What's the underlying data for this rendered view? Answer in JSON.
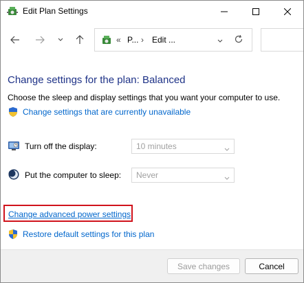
{
  "window": {
    "title": "Edit Plan Settings"
  },
  "nav": {
    "back_icon": "arrow-left-icon",
    "forward_icon": "arrow-right-icon",
    "recent_icon": "chevron-down-icon",
    "up_icon": "arrow-up-icon"
  },
  "address": {
    "sep": "«",
    "crumb1": "P...",
    "sep2": "›",
    "crumb2": "Edit ..."
  },
  "content": {
    "heading": "Change settings for the plan: Balanced",
    "subtitle": "Choose the sleep and display settings that you want your computer to use.",
    "unavailable_link": "Change settings that are currently unavailable",
    "display_label": "Turn off the display:",
    "display_value": "10 minutes",
    "sleep_label": "Put the computer to sleep:",
    "sleep_value": "Never",
    "advanced_link": "Change advanced power settings",
    "restore_link": "Restore default settings for this plan"
  },
  "footer": {
    "save_label": "Save changes",
    "cancel_label": "Cancel"
  },
  "colors": {
    "heading": "#1e3287",
    "link": "#0066cc",
    "highlight_border": "#d0121b"
  }
}
